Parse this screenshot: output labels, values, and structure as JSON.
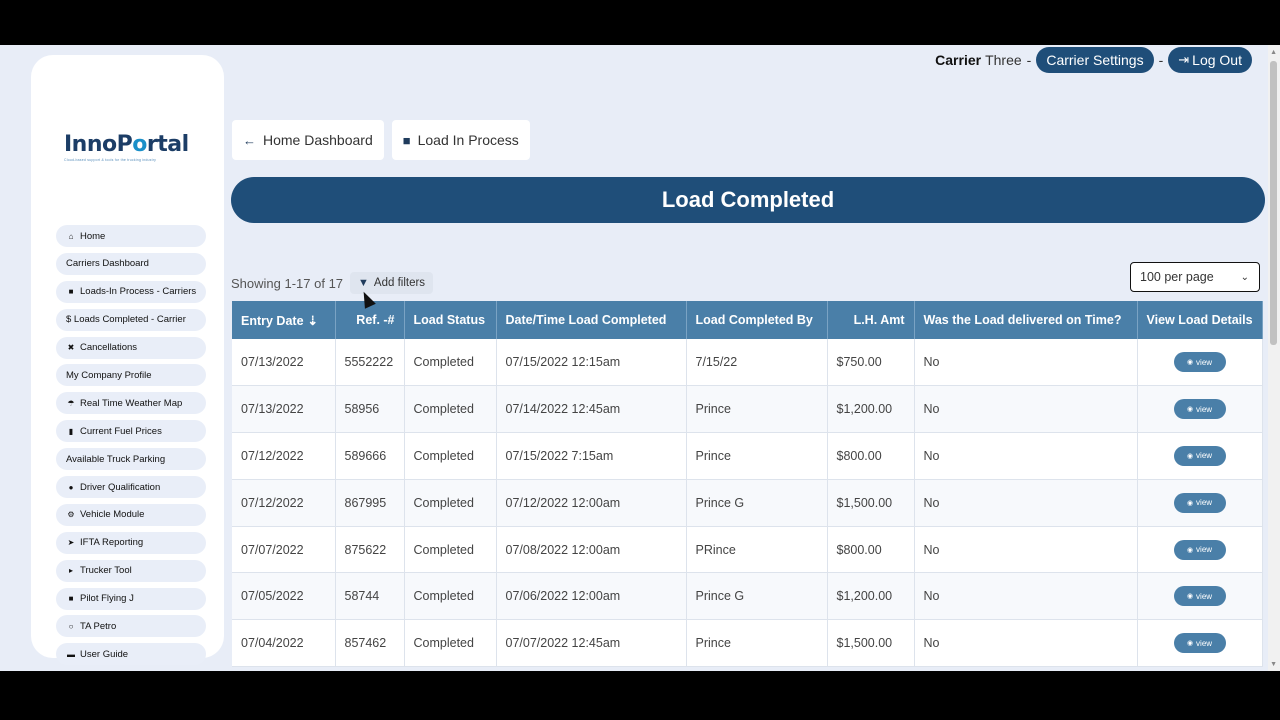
{
  "app": {
    "logo": {
      "part1": "Inno",
      "part2": "P",
      "part3": "o",
      "part4": "rtal",
      "tagline": "Cloud-based support & tools for the trucking industry"
    }
  },
  "header": {
    "user_first": "Carrier",
    "user_last": "Three",
    "separator": "-",
    "settings_label": "Carrier Settings",
    "logout_label": "Log Out"
  },
  "sidebar": {
    "items": [
      {
        "icon": "home-icon",
        "glyph": "⌂",
        "label": "Home"
      },
      {
        "icon": "",
        "glyph": "",
        "label": "Carriers Dashboard"
      },
      {
        "icon": "truck-icon",
        "glyph": "■",
        "label": "Loads-In Process - Carriers"
      },
      {
        "icon": "dollar-icon",
        "glyph": "",
        "label": "$ Loads Completed - Carrier"
      },
      {
        "icon": "close-icon",
        "glyph": "✖",
        "label": "Cancellations"
      },
      {
        "icon": "",
        "glyph": "",
        "label": "My Company Profile"
      },
      {
        "icon": "umbrella-icon",
        "glyph": "☂",
        "label": "Real Time Weather Map"
      },
      {
        "icon": "fuel-icon",
        "glyph": "▮",
        "label": "Current Fuel Prices"
      },
      {
        "icon": "",
        "glyph": "",
        "label": "Available Truck Parking"
      },
      {
        "icon": "circle-icon",
        "glyph": "●",
        "label": "Driver Qualification"
      },
      {
        "icon": "gears-icon",
        "glyph": "⚙",
        "label": "Vehicle Module"
      },
      {
        "icon": "send-icon",
        "glyph": "➤",
        "label": "IFTA Reporting"
      },
      {
        "icon": "caret-right-icon",
        "glyph": "▸",
        "label": "Trucker Tool"
      },
      {
        "icon": "square-icon",
        "glyph": "■",
        "label": "Pilot Flying J"
      },
      {
        "icon": "circle-outline-icon",
        "glyph": "○",
        "label": "TA Petro"
      },
      {
        "icon": "book-icon",
        "glyph": "▬",
        "label": "User Guide"
      }
    ]
  },
  "crumbs": {
    "home_label": "Home Dashboard",
    "process_label": "Load In Process"
  },
  "page": {
    "title": "Load Completed",
    "showing": "Showing 1-17 of 17",
    "filter_label": "Add filters",
    "per_page": "100 per page"
  },
  "table": {
    "columns": [
      "Entry Date",
      "Ref. -#",
      "Load Status",
      "Date/Time Load Completed",
      "Load Completed By",
      "L.H. Amt",
      "Was the Load delivered on Time?",
      "View Load Details"
    ],
    "rows": [
      [
        "07/13/2022",
        "5552222",
        "Completed",
        "07/15/2022 12:15am",
        "7/15/22",
        "$750.00",
        "No",
        "view"
      ],
      [
        "07/13/2022",
        "58956",
        "Completed",
        "07/14/2022 12:45am",
        "Prince",
        "$1,200.00",
        "No",
        "view"
      ],
      [
        "07/12/2022",
        "589666",
        "Completed",
        "07/15/2022 7:15am",
        "Prince",
        "$800.00",
        "No",
        "view"
      ],
      [
        "07/12/2022",
        "867995",
        "Completed",
        "07/12/2022 12:00am",
        "Prince G",
        "$1,500.00",
        "No",
        "view"
      ],
      [
        "07/07/2022",
        "875622",
        "Completed",
        "07/08/2022 12:00am",
        "PRince",
        "$800.00",
        "No",
        "view"
      ],
      [
        "07/05/2022",
        "58744",
        "Completed",
        "07/06/2022 12:00am",
        "Prince G",
        "$1,200.00",
        "No",
        "view"
      ],
      [
        "07/04/2022",
        "857462",
        "Completed",
        "07/07/2022 12:45am",
        "Prince",
        "$1,500.00",
        "No",
        "view"
      ]
    ]
  }
}
